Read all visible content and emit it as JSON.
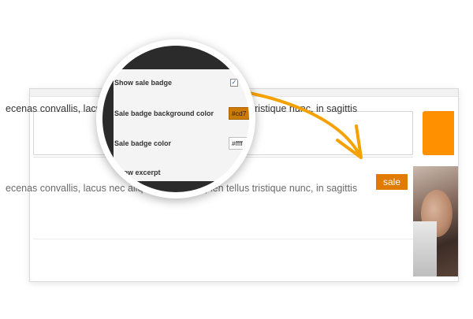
{
  "settings_panel": {
    "items": [
      {
        "label": "Show sale badge",
        "control": "checkbox",
        "checked": true
      },
      {
        "label": "Sale badge background color",
        "control": "color",
        "value": "#cd7"
      },
      {
        "label": "Sale badge color",
        "control": "color",
        "value": "#ffff"
      },
      {
        "label": "Show excerpt",
        "control": "checkbox",
        "checked": false
      }
    ]
  },
  "preview": {
    "excerpt_line_1": "ecenas convallis, lacus nec aliquet viverra, sapien tellus tristique nunc, in sagittis",
    "excerpt_line_2": "ecenas convallis, lacus nec aliquet viverra, sapien tellus tristique nunc, in sagittis",
    "sale_badge_label": "sale"
  },
  "colors": {
    "accent_orange": "#ff9100",
    "sale_badge_bg": "#e07a00",
    "arrow": "#f5a100"
  },
  "icons": {
    "checkbox_checked": "check-icon",
    "arrow": "curved-arrow-icon"
  }
}
